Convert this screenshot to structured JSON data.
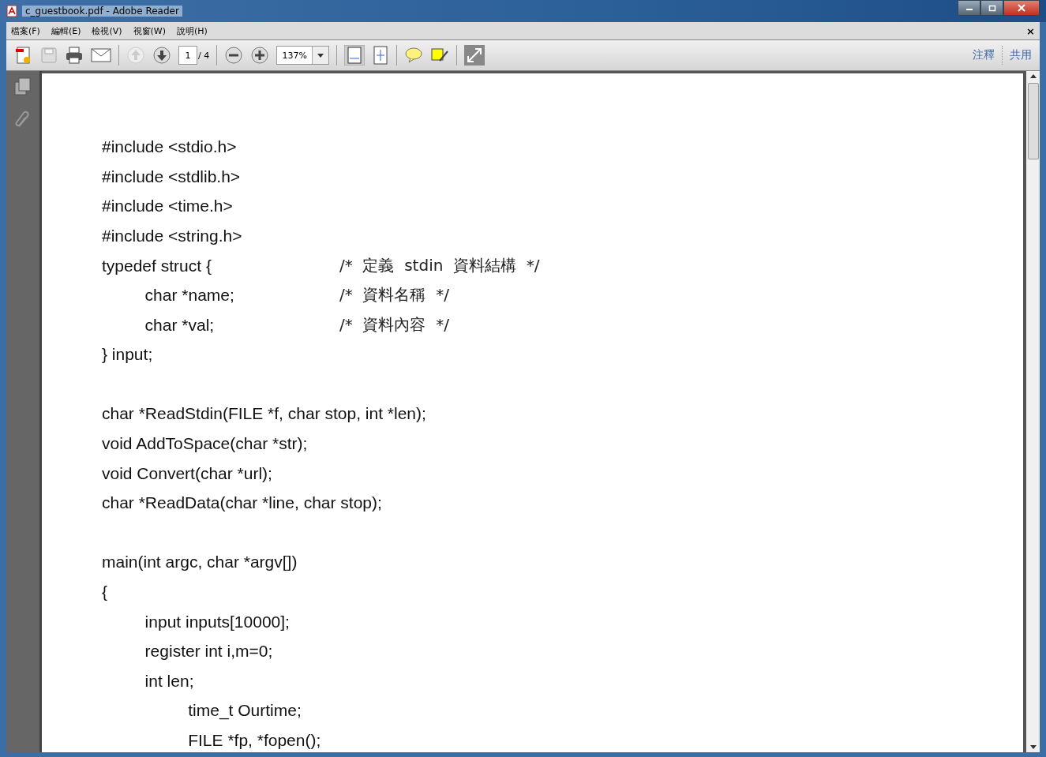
{
  "window": {
    "title": "c_guestbook.pdf - Adobe Reader"
  },
  "menu": [
    "檔案(F)",
    "編輯(E)",
    "檢視(V)",
    "視窗(W)",
    "說明(H)"
  ],
  "menu_close": "×",
  "toolbar": {
    "page": "1",
    "page_total": "/ 4",
    "zoom": "137%",
    "right_links": [
      "注釋",
      "共用"
    ]
  },
  "document": {
    "lines": [
      {
        "kind": "code",
        "text": "#include <stdio.h>"
      },
      {
        "kind": "code",
        "text": "#include <stdlib.h>"
      },
      {
        "kind": "code",
        "text": "#include <time.h>"
      },
      {
        "kind": "code",
        "text": "#include <string.h>"
      },
      {
        "kind": "code",
        "text": "typedef struct {",
        "comment": "/*  定義  stdin  資料結構  */"
      },
      {
        "kind": "code",
        "text": "\tchar *name;",
        "comment": "/*  資料名稱  */"
      },
      {
        "kind": "code",
        "text": "\tchar *val;",
        "comment": "/*  資料內容  */"
      },
      {
        "kind": "code",
        "text": "} input;"
      },
      {
        "kind": "blank"
      },
      {
        "kind": "code",
        "text": "char *ReadStdin(FILE *f, char stop, int *len);"
      },
      {
        "kind": "code",
        "text": "void AddToSpace(char *str);"
      },
      {
        "kind": "code",
        "text": "void Convert(char *url);"
      },
      {
        "kind": "code",
        "text": "char *ReadData(char *line, char stop);"
      },
      {
        "kind": "blank"
      },
      {
        "kind": "code",
        "text": "main(int argc, char *argv[])"
      },
      {
        "kind": "code",
        "text": "{"
      },
      {
        "kind": "code",
        "text": "\tinput inputs[10000];"
      },
      {
        "kind": "code",
        "text": "\tregister int i,m=0;"
      },
      {
        "kind": "code",
        "text": "\tint len;"
      },
      {
        "kind": "code",
        "text": "\t\ttime_t Ourtime;"
      },
      {
        "kind": "code",
        "text": "\t\tFILE *fp, *fopen();"
      }
    ]
  }
}
